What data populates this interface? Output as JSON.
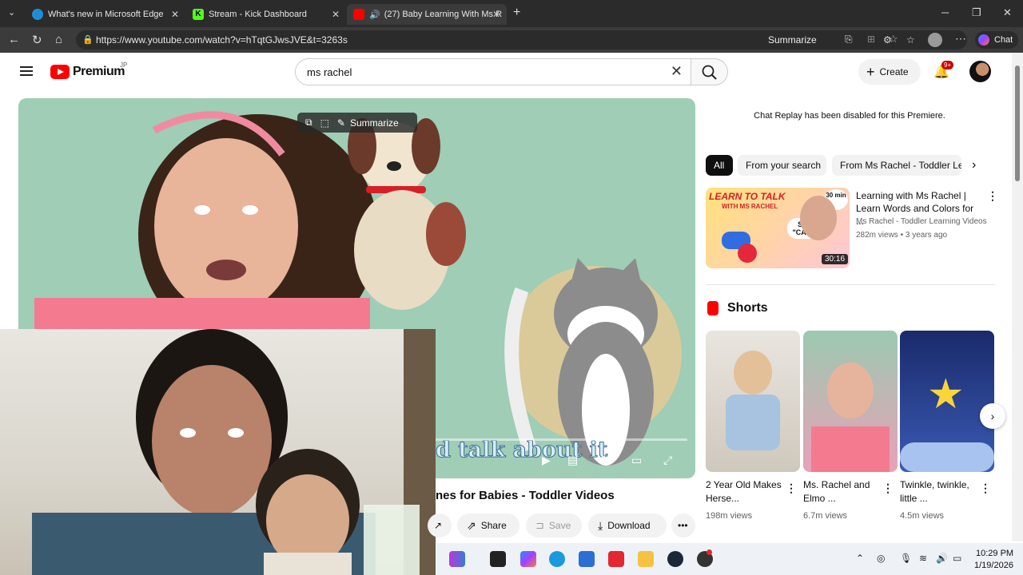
{
  "browser": {
    "tabs": [
      {
        "title": "What's new in Microsoft Edge",
        "color": "#1f8dd6"
      },
      {
        "title": "Stream - Kick Dashboard",
        "color": "#53fc18"
      },
      {
        "title": "(27) Baby Learning With Ms R",
        "color": "#ff0000"
      }
    ],
    "url": "https://www.youtube.com/watch?v=hTqtGJwsJVE&t=3263s",
    "summarize_label": "Summarize",
    "chat_label": "Chat"
  },
  "header": {
    "logo_text": "Premium",
    "logo_region": "JP",
    "search_value": "ms rachel",
    "create_label": "Create",
    "notification_badge": "9+"
  },
  "video": {
    "toolbar_summarize": "Summarize",
    "caption_text": "d talk about it",
    "title": "nes for Babies - Toddler Videos",
    "actions": {
      "share": "Share",
      "save": "Save",
      "download": "Download"
    }
  },
  "side": {
    "chat_replay_text": "Chat Replay has been disabled for this Premiere.",
    "chips": [
      "All",
      "From your search",
      "From Ms Rachel - Toddler Le"
    ],
    "recommended": {
      "title": "Learning with Ms Rachel | Learn Words and Colors for ...",
      "channel": "Ms Rachel - Toddler Learning Videos",
      "meta": "282m views • 3 years ago",
      "duration": "30:16",
      "thumb_text_1": "LEARN TO TALK",
      "thumb_text_2": "WITH MS RACHEL",
      "thumb_badge": "30 min",
      "thumb_bubble": "Say, \"CAR!\""
    },
    "shorts_title": "Shorts",
    "shorts": [
      {
        "title": "2 Year Old Makes Herse...",
        "views": "198m views"
      },
      {
        "title": "Ms. Rachel and Elmo ...",
        "views": "6.7m views"
      },
      {
        "title": "Twinkle, twinkle, little ...",
        "views": "4.5m views"
      }
    ]
  },
  "taskbar": {
    "time": "10:29 PM",
    "date": "1/19/2026"
  }
}
